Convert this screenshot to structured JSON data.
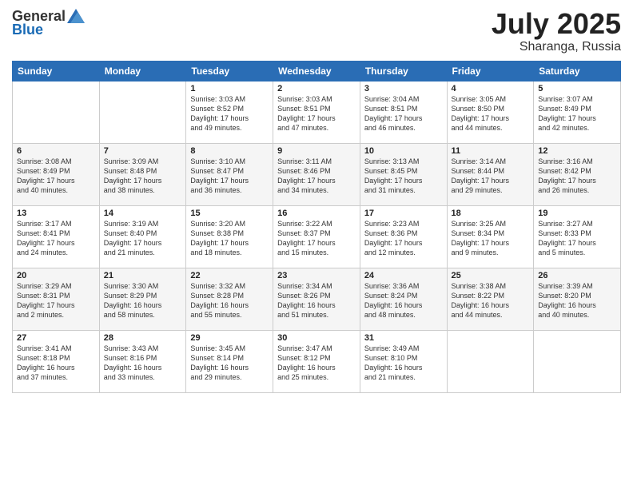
{
  "logo": {
    "general": "General",
    "blue": "Blue"
  },
  "title": {
    "month": "July 2025",
    "location": "Sharanga, Russia"
  },
  "days_header": [
    "Sunday",
    "Monday",
    "Tuesday",
    "Wednesday",
    "Thursday",
    "Friday",
    "Saturday"
  ],
  "weeks": [
    [
      {
        "day": "",
        "info": ""
      },
      {
        "day": "",
        "info": ""
      },
      {
        "day": "1",
        "info": "Sunrise: 3:03 AM\nSunset: 8:52 PM\nDaylight: 17 hours\nand 49 minutes."
      },
      {
        "day": "2",
        "info": "Sunrise: 3:03 AM\nSunset: 8:51 PM\nDaylight: 17 hours\nand 47 minutes."
      },
      {
        "day": "3",
        "info": "Sunrise: 3:04 AM\nSunset: 8:51 PM\nDaylight: 17 hours\nand 46 minutes."
      },
      {
        "day": "4",
        "info": "Sunrise: 3:05 AM\nSunset: 8:50 PM\nDaylight: 17 hours\nand 44 minutes."
      },
      {
        "day": "5",
        "info": "Sunrise: 3:07 AM\nSunset: 8:49 PM\nDaylight: 17 hours\nand 42 minutes."
      }
    ],
    [
      {
        "day": "6",
        "info": "Sunrise: 3:08 AM\nSunset: 8:49 PM\nDaylight: 17 hours\nand 40 minutes."
      },
      {
        "day": "7",
        "info": "Sunrise: 3:09 AM\nSunset: 8:48 PM\nDaylight: 17 hours\nand 38 minutes."
      },
      {
        "day": "8",
        "info": "Sunrise: 3:10 AM\nSunset: 8:47 PM\nDaylight: 17 hours\nand 36 minutes."
      },
      {
        "day": "9",
        "info": "Sunrise: 3:11 AM\nSunset: 8:46 PM\nDaylight: 17 hours\nand 34 minutes."
      },
      {
        "day": "10",
        "info": "Sunrise: 3:13 AM\nSunset: 8:45 PM\nDaylight: 17 hours\nand 31 minutes."
      },
      {
        "day": "11",
        "info": "Sunrise: 3:14 AM\nSunset: 8:44 PM\nDaylight: 17 hours\nand 29 minutes."
      },
      {
        "day": "12",
        "info": "Sunrise: 3:16 AM\nSunset: 8:42 PM\nDaylight: 17 hours\nand 26 minutes."
      }
    ],
    [
      {
        "day": "13",
        "info": "Sunrise: 3:17 AM\nSunset: 8:41 PM\nDaylight: 17 hours\nand 24 minutes."
      },
      {
        "day": "14",
        "info": "Sunrise: 3:19 AM\nSunset: 8:40 PM\nDaylight: 17 hours\nand 21 minutes."
      },
      {
        "day": "15",
        "info": "Sunrise: 3:20 AM\nSunset: 8:38 PM\nDaylight: 17 hours\nand 18 minutes."
      },
      {
        "day": "16",
        "info": "Sunrise: 3:22 AM\nSunset: 8:37 PM\nDaylight: 17 hours\nand 15 minutes."
      },
      {
        "day": "17",
        "info": "Sunrise: 3:23 AM\nSunset: 8:36 PM\nDaylight: 17 hours\nand 12 minutes."
      },
      {
        "day": "18",
        "info": "Sunrise: 3:25 AM\nSunset: 8:34 PM\nDaylight: 17 hours\nand 9 minutes."
      },
      {
        "day": "19",
        "info": "Sunrise: 3:27 AM\nSunset: 8:33 PM\nDaylight: 17 hours\nand 5 minutes."
      }
    ],
    [
      {
        "day": "20",
        "info": "Sunrise: 3:29 AM\nSunset: 8:31 PM\nDaylight: 17 hours\nand 2 minutes."
      },
      {
        "day": "21",
        "info": "Sunrise: 3:30 AM\nSunset: 8:29 PM\nDaylight: 16 hours\nand 58 minutes."
      },
      {
        "day": "22",
        "info": "Sunrise: 3:32 AM\nSunset: 8:28 PM\nDaylight: 16 hours\nand 55 minutes."
      },
      {
        "day": "23",
        "info": "Sunrise: 3:34 AM\nSunset: 8:26 PM\nDaylight: 16 hours\nand 51 minutes."
      },
      {
        "day": "24",
        "info": "Sunrise: 3:36 AM\nSunset: 8:24 PM\nDaylight: 16 hours\nand 48 minutes."
      },
      {
        "day": "25",
        "info": "Sunrise: 3:38 AM\nSunset: 8:22 PM\nDaylight: 16 hours\nand 44 minutes."
      },
      {
        "day": "26",
        "info": "Sunrise: 3:39 AM\nSunset: 8:20 PM\nDaylight: 16 hours\nand 40 minutes."
      }
    ],
    [
      {
        "day": "27",
        "info": "Sunrise: 3:41 AM\nSunset: 8:18 PM\nDaylight: 16 hours\nand 37 minutes."
      },
      {
        "day": "28",
        "info": "Sunrise: 3:43 AM\nSunset: 8:16 PM\nDaylight: 16 hours\nand 33 minutes."
      },
      {
        "day": "29",
        "info": "Sunrise: 3:45 AM\nSunset: 8:14 PM\nDaylight: 16 hours\nand 29 minutes."
      },
      {
        "day": "30",
        "info": "Sunrise: 3:47 AM\nSunset: 8:12 PM\nDaylight: 16 hours\nand 25 minutes."
      },
      {
        "day": "31",
        "info": "Sunrise: 3:49 AM\nSunset: 8:10 PM\nDaylight: 16 hours\nand 21 minutes."
      },
      {
        "day": "",
        "info": ""
      },
      {
        "day": "",
        "info": ""
      }
    ]
  ]
}
